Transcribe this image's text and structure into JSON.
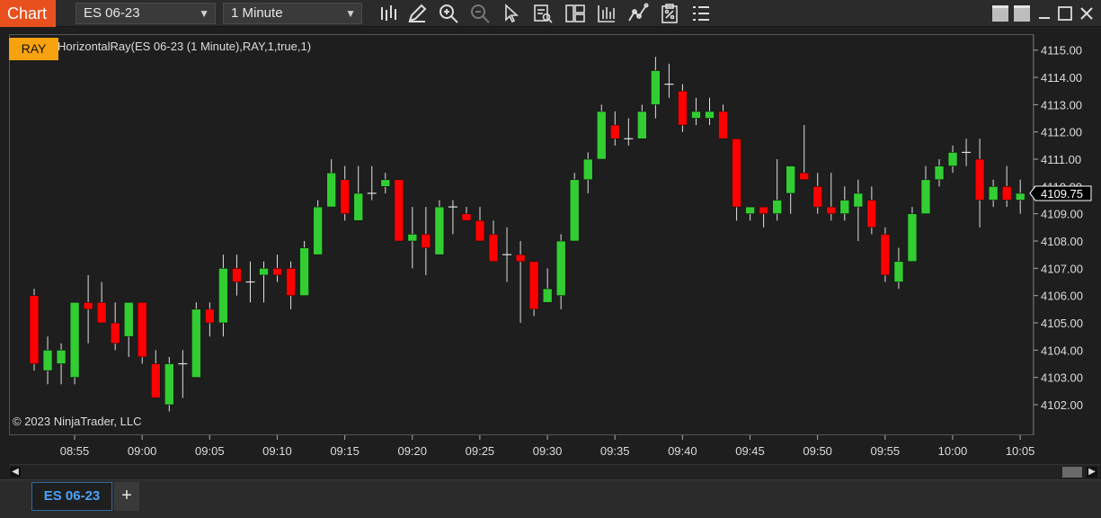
{
  "window": {
    "title": "Chart"
  },
  "toolbar": {
    "instrument": "ES 06-23",
    "interval": "1 Minute",
    "icons": [
      "bar-type-icon",
      "draw-icon",
      "zoom-in-icon",
      "zoom-out-icon",
      "select-icon",
      "data-box-icon",
      "templates-icon",
      "strategies-icon",
      "indicators-icon",
      "properties-icon",
      "list-icon"
    ]
  },
  "chart": {
    "indicator_button": "RAY",
    "indicator_label": "HorizontalRay(ES 06-23 (1 Minute),RAY,1,true,1)",
    "copyright": "© 2023 NinjaTrader, LLC",
    "current_price_label": "4109.75",
    "colors": {
      "up": "#32cd32",
      "down": "#ff0000",
      "background": "#1e1e1e",
      "axis_text": "#dcdcdc",
      "price_marker_bg": "#000000"
    }
  },
  "chart_data": {
    "type": "candlestick",
    "instrument": "ES 06-23",
    "interval": "1 Minute",
    "ylim": [
      4101.5,
      4115.25
    ],
    "y_ticks": [
      "4102.00",
      "4103.00",
      "4104.00",
      "4105.00",
      "4106.00",
      "4107.00",
      "4108.00",
      "4109.00",
      "4110.00",
      "4111.00",
      "4112.00",
      "4113.00",
      "4114.00",
      "4115.00"
    ],
    "x_ticks": [
      "08:55",
      "09:00",
      "09:05",
      "09:10",
      "09:15",
      "09:20",
      "09:25",
      "09:30",
      "09:35",
      "09:40",
      "09:45",
      "09:50",
      "09:55",
      "10:00",
      "10:05"
    ],
    "last_price": 4109.75,
    "candles": [
      {
        "o": 4106.0,
        "h": 4106.25,
        "l": 4103.25,
        "c": 4103.5
      },
      {
        "o": 4103.25,
        "h": 4104.5,
        "l": 4102.75,
        "c": 4104.0
      },
      {
        "o": 4103.5,
        "h": 4104.25,
        "l": 4102.75,
        "c": 4104.0
      },
      {
        "o": 4103.0,
        "h": 4105.75,
        "l": 4102.75,
        "c": 4105.75
      },
      {
        "o": 4105.75,
        "h": 4106.75,
        "l": 4104.25,
        "c": 4105.5
      },
      {
        "o": 4105.75,
        "h": 4106.5,
        "l": 4105.0,
        "c": 4105.0
      },
      {
        "o": 4105.0,
        "h": 4105.75,
        "l": 4104.0,
        "c": 4104.25
      },
      {
        "o": 4104.5,
        "h": 4105.75,
        "l": 4103.75,
        "c": 4105.75
      },
      {
        "o": 4105.75,
        "h": 4105.75,
        "l": 4103.5,
        "c": 4103.75
      },
      {
        "o": 4103.5,
        "h": 4104.0,
        "l": 4102.25,
        "c": 4102.25
      },
      {
        "o": 4102.0,
        "h": 4103.75,
        "l": 4101.75,
        "c": 4103.5
      },
      {
        "o": 4103.5,
        "h": 4104.0,
        "l": 4102.25,
        "c": 4103.5
      },
      {
        "o": 4103.0,
        "h": 4105.75,
        "l": 4103.0,
        "c": 4105.5
      },
      {
        "o": 4105.5,
        "h": 4105.75,
        "l": 4104.5,
        "c": 4105.0
      },
      {
        "o": 4105.0,
        "h": 4107.5,
        "l": 4104.5,
        "c": 4107.0
      },
      {
        "o": 4107.0,
        "h": 4107.5,
        "l": 4106.0,
        "c": 4106.5
      },
      {
        "o": 4106.5,
        "h": 4107.25,
        "l": 4105.75,
        "c": 4106.5
      },
      {
        "o": 4106.75,
        "h": 4107.25,
        "l": 4105.75,
        "c": 4107.0
      },
      {
        "o": 4107.0,
        "h": 4107.5,
        "l": 4106.5,
        "c": 4106.75
      },
      {
        "o": 4107.0,
        "h": 4107.25,
        "l": 4105.5,
        "c": 4106.0
      },
      {
        "o": 4106.0,
        "h": 4108.0,
        "l": 4106.0,
        "c": 4107.75
      },
      {
        "o": 4107.5,
        "h": 4109.5,
        "l": 4107.5,
        "c": 4109.25
      },
      {
        "o": 4109.25,
        "h": 4111.0,
        "l": 4109.25,
        "c": 4110.5
      },
      {
        "o": 4110.25,
        "h": 4110.75,
        "l": 4108.75,
        "c": 4109.0
      },
      {
        "o": 4108.75,
        "h": 4110.75,
        "l": 4108.75,
        "c": 4109.75
      },
      {
        "o": 4109.75,
        "h": 4110.75,
        "l": 4109.5,
        "c": 4109.75
      },
      {
        "o": 4110.0,
        "h": 4110.5,
        "l": 4109.75,
        "c": 4110.25
      },
      {
        "o": 4110.25,
        "h": 4110.25,
        "l": 4108.0,
        "c": 4108.0
      },
      {
        "o": 4108.0,
        "h": 4109.25,
        "l": 4107.0,
        "c": 4108.25
      },
      {
        "o": 4108.25,
        "h": 4109.25,
        "l": 4106.75,
        "c": 4107.75
      },
      {
        "o": 4107.5,
        "h": 4109.5,
        "l": 4107.5,
        "c": 4109.25
      },
      {
        "o": 4109.25,
        "h": 4109.5,
        "l": 4108.25,
        "c": 4109.25
      },
      {
        "o": 4109.0,
        "h": 4109.25,
        "l": 4108.75,
        "c": 4108.75
      },
      {
        "o": 4108.75,
        "h": 4109.25,
        "l": 4108.0,
        "c": 4108.0
      },
      {
        "o": 4108.25,
        "h": 4108.75,
        "l": 4107.25,
        "c": 4107.25
      },
      {
        "o": 4107.5,
        "h": 4108.5,
        "l": 4106.5,
        "c": 4107.5
      },
      {
        "o": 4107.5,
        "h": 4108.0,
        "l": 4105.0,
        "c": 4107.25
      },
      {
        "o": 4107.25,
        "h": 4107.25,
        "l": 4105.25,
        "c": 4105.5
      },
      {
        "o": 4105.75,
        "h": 4107.0,
        "l": 4105.75,
        "c": 4106.25
      },
      {
        "o": 4106.0,
        "h": 4108.25,
        "l": 4105.5,
        "c": 4108.0
      },
      {
        "o": 4108.0,
        "h": 4110.5,
        "l": 4108.0,
        "c": 4110.25
      },
      {
        "o": 4110.25,
        "h": 4111.25,
        "l": 4109.75,
        "c": 4111.0
      },
      {
        "o": 4111.0,
        "h": 4113.0,
        "l": 4111.0,
        "c": 4112.75
      },
      {
        "o": 4112.25,
        "h": 4112.75,
        "l": 4111.5,
        "c": 4111.75
      },
      {
        "o": 4111.75,
        "h": 4112.5,
        "l": 4111.5,
        "c": 4111.75
      },
      {
        "o": 4111.75,
        "h": 4113.0,
        "l": 4111.75,
        "c": 4112.75
      },
      {
        "o": 4113.0,
        "h": 4114.75,
        "l": 4112.5,
        "c": 4114.25
      },
      {
        "o": 4113.75,
        "h": 4114.5,
        "l": 4113.25,
        "c": 4113.75
      },
      {
        "o": 4113.5,
        "h": 4113.75,
        "l": 4112.0,
        "c": 4112.25
      },
      {
        "o": 4112.5,
        "h": 4113.25,
        "l": 4112.25,
        "c": 4112.75
      },
      {
        "o": 4112.5,
        "h": 4113.25,
        "l": 4112.25,
        "c": 4112.75
      },
      {
        "o": 4112.75,
        "h": 4113.0,
        "l": 4111.75,
        "c": 4111.75
      },
      {
        "o": 4111.75,
        "h": 4111.75,
        "l": 4108.75,
        "c": 4109.25
      },
      {
        "o": 4109.0,
        "h": 4109.25,
        "l": 4108.75,
        "c": 4109.25
      },
      {
        "o": 4109.25,
        "h": 4109.25,
        "l": 4108.5,
        "c": 4109.0
      },
      {
        "o": 4109.0,
        "h": 4111.0,
        "l": 4108.75,
        "c": 4109.5
      },
      {
        "o": 4109.75,
        "h": 4110.75,
        "l": 4109.0,
        "c": 4110.75
      },
      {
        "o": 4110.5,
        "h": 4112.25,
        "l": 4110.25,
        "c": 4110.25
      },
      {
        "o": 4110.0,
        "h": 4110.5,
        "l": 4109.0,
        "c": 4109.25
      },
      {
        "o": 4109.25,
        "h": 4110.5,
        "l": 4108.75,
        "c": 4109.0
      },
      {
        "o": 4109.0,
        "h": 4110.0,
        "l": 4108.75,
        "c": 4109.5
      },
      {
        "o": 4109.25,
        "h": 4110.25,
        "l": 4108.0,
        "c": 4109.75
      },
      {
        "o": 4109.5,
        "h": 4110.0,
        "l": 4108.25,
        "c": 4108.5
      },
      {
        "o": 4108.25,
        "h": 4108.5,
        "l": 4106.5,
        "c": 4106.75
      },
      {
        "o": 4106.5,
        "h": 4107.75,
        "l": 4106.25,
        "c": 4107.25
      },
      {
        "o": 4107.25,
        "h": 4109.25,
        "l": 4107.25,
        "c": 4109.0
      },
      {
        "o": 4109.0,
        "h": 4110.75,
        "l": 4109.0,
        "c": 4110.25
      },
      {
        "o": 4110.25,
        "h": 4111.0,
        "l": 4110.0,
        "c": 4110.75
      },
      {
        "o": 4110.75,
        "h": 4111.5,
        "l": 4110.5,
        "c": 4111.25
      },
      {
        "o": 4111.25,
        "h": 4111.75,
        "l": 4110.75,
        "c": 4111.25
      },
      {
        "o": 4111.0,
        "h": 4111.75,
        "l": 4108.5,
        "c": 4109.5
      },
      {
        "o": 4109.5,
        "h": 4110.25,
        "l": 4109.25,
        "c": 4110.0
      },
      {
        "o": 4110.0,
        "h": 4110.75,
        "l": 4109.25,
        "c": 4109.5
      },
      {
        "o": 4109.5,
        "h": 4110.25,
        "l": 4109.0,
        "c": 4109.75
      }
    ]
  },
  "tabs": [
    {
      "label": "ES 06-23"
    }
  ],
  "tabbar": {
    "add_label": "+"
  }
}
